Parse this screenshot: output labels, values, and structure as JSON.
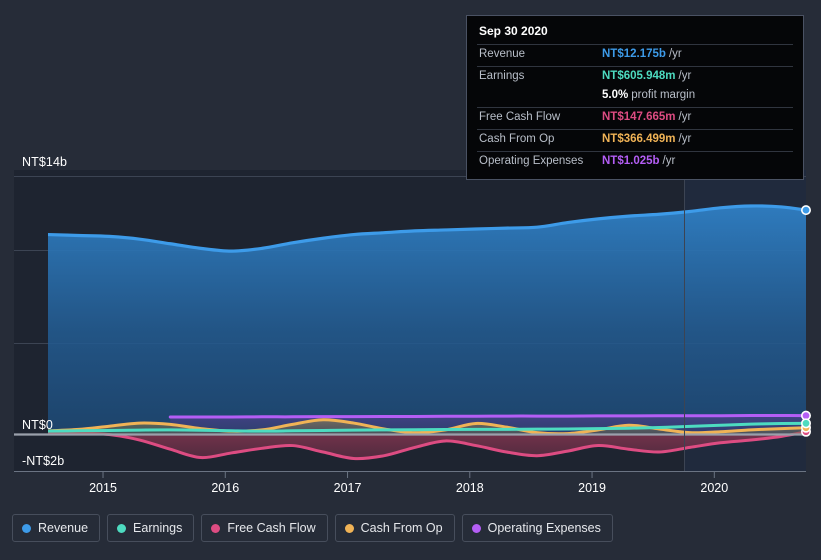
{
  "chart_data": {
    "type": "area",
    "title": "",
    "xlabel": "",
    "ylabel": "",
    "ylim": [
      -2,
      14
    ],
    "y_unit": "NT$",
    "grid": true,
    "legend_position": "bottom-left",
    "y_ticks": [
      {
        "label": "NT$14b",
        "value": 14
      },
      {
        "label": "NT$0",
        "value": 0
      },
      {
        "label": "-NT$2b",
        "value": -2
      }
    ],
    "x_ticks": [
      {
        "label": "2015",
        "value": 2015
      },
      {
        "label": "2016",
        "value": 2016
      },
      {
        "label": "2017",
        "value": 2017
      },
      {
        "label": "2018",
        "value": 2018
      },
      {
        "label": "2019",
        "value": 2019
      },
      {
        "label": "2020",
        "value": 2020
      }
    ],
    "x": [
      2014.55,
      2014.8,
      2015.05,
      2015.3,
      2015.55,
      2015.8,
      2016.05,
      2016.3,
      2016.55,
      2016.8,
      2017.05,
      2017.3,
      2017.55,
      2017.8,
      2018.05,
      2018.3,
      2018.55,
      2018.8,
      2019.05,
      2019.3,
      2019.55,
      2019.8,
      2020.05,
      2020.3,
      2020.55,
      2020.75
    ],
    "series": [
      {
        "name": "Revenue",
        "color": "#3d9be9",
        "values": [
          10.85,
          10.8,
          10.75,
          10.6,
          10.35,
          10.1,
          9.95,
          10.1,
          10.4,
          10.65,
          10.85,
          10.95,
          11.05,
          11.1,
          11.15,
          11.2,
          11.25,
          11.5,
          11.7,
          11.85,
          11.95,
          12.1,
          12.3,
          12.4,
          12.35,
          12.175
        ]
      },
      {
        "name": "Earnings",
        "color": "#4ddbc0",
        "values": [
          0.18,
          0.2,
          0.22,
          0.24,
          0.25,
          0.23,
          0.2,
          0.18,
          0.2,
          0.22,
          0.24,
          0.25,
          0.26,
          0.27,
          0.28,
          0.28,
          0.29,
          0.3,
          0.32,
          0.34,
          0.38,
          0.44,
          0.5,
          0.56,
          0.6,
          0.605948
        ]
      },
      {
        "name": "Free Cash Flow",
        "color": "#dd4c82",
        "values": [
          0.1,
          0.08,
          0.0,
          -0.3,
          -0.8,
          -1.25,
          -1.0,
          -0.75,
          -0.6,
          -0.95,
          -1.3,
          -1.15,
          -0.7,
          -0.35,
          -0.6,
          -0.95,
          -1.15,
          -0.9,
          -0.6,
          -0.8,
          -0.95,
          -0.7,
          -0.45,
          -0.3,
          -0.1,
          0.147665
        ]
      },
      {
        "name": "Cash From Op",
        "color": "#f0b356",
        "values": [
          0.2,
          0.28,
          0.45,
          0.62,
          0.55,
          0.32,
          0.18,
          0.25,
          0.55,
          0.8,
          0.62,
          0.3,
          0.1,
          0.25,
          0.6,
          0.4,
          0.1,
          0.05,
          0.25,
          0.5,
          0.3,
          0.1,
          0.15,
          0.25,
          0.32,
          0.366499
        ]
      },
      {
        "name": "Operating Expenses",
        "color": "#b45ef5",
        "values": [
          null,
          null,
          null,
          null,
          0.95,
          0.95,
          0.95,
          0.96,
          0.96,
          0.97,
          0.97,
          0.98,
          0.98,
          0.99,
          0.99,
          1.0,
          1.0,
          1.0,
          1.01,
          1.01,
          1.02,
          1.02,
          1.02,
          1.03,
          1.03,
          1.025
        ]
      }
    ]
  },
  "tooltip": {
    "date": "Sep 30 2020",
    "rows": [
      {
        "key": "Revenue",
        "value": "NT$12.175b",
        "unit": "/yr",
        "color": "#3d9be9"
      },
      {
        "key": "Earnings",
        "value": "NT$605.948m",
        "unit": "/yr",
        "color": "#4ddbc0"
      },
      {
        "key": "",
        "value": "5.0%",
        "unit": "profit margin",
        "color": "#ffffff"
      },
      {
        "key": "Free Cash Flow",
        "value": "NT$147.665m",
        "unit": "/yr",
        "color": "#dd4c82"
      },
      {
        "key": "Cash From Op",
        "value": "NT$366.499m",
        "unit": "/yr",
        "color": "#f0b356"
      },
      {
        "key": "Operating Expenses",
        "value": "NT$1.025b",
        "unit": "/yr",
        "color": "#b45ef5"
      }
    ]
  },
  "legend": {
    "items": [
      {
        "label": "Revenue",
        "color": "#3d9be9"
      },
      {
        "label": "Earnings",
        "color": "#4ddbc0"
      },
      {
        "label": "Free Cash Flow",
        "color": "#dd4c82"
      },
      {
        "label": "Cash From Op",
        "color": "#f0b356"
      },
      {
        "label": "Operating Expenses",
        "color": "#b45ef5"
      }
    ]
  },
  "colors": {
    "background": "#262c38",
    "plot_background": "#1e2430",
    "gridline": "#3c4453",
    "zero_line": "#9aa0ab",
    "axis_line": "#4a5263",
    "tooltip_background": "#050608",
    "tooltip_border": "#4a5263"
  }
}
